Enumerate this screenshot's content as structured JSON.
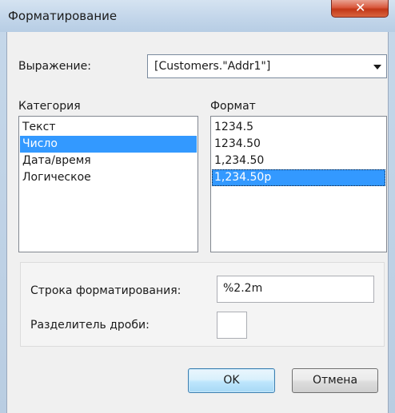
{
  "window": {
    "title": "Форматирование"
  },
  "expression": {
    "label": "Выражение:",
    "value": "[Customers.\"Addr1\"]"
  },
  "category": {
    "label": "Категория",
    "items": [
      "Текст",
      "Число",
      "Дата/время",
      "Логическое"
    ],
    "selected_index": 1
  },
  "format": {
    "label": "Формат",
    "items": [
      "1234.5",
      "1234.50",
      "1,234.50",
      "1,234.50р"
    ],
    "selected_index": 3
  },
  "format_string": {
    "label": "Строка форматирования:",
    "value": "%2.2m"
  },
  "decimal_separator": {
    "label": "Разделитель дроби:",
    "value": ""
  },
  "buttons": {
    "ok": "OK",
    "cancel": "Отмена"
  },
  "icons": {
    "close": "close-icon",
    "dropdown": "chevron-down-icon"
  },
  "colors": {
    "selection": "#3399ff",
    "close_button": "#c9462a"
  }
}
